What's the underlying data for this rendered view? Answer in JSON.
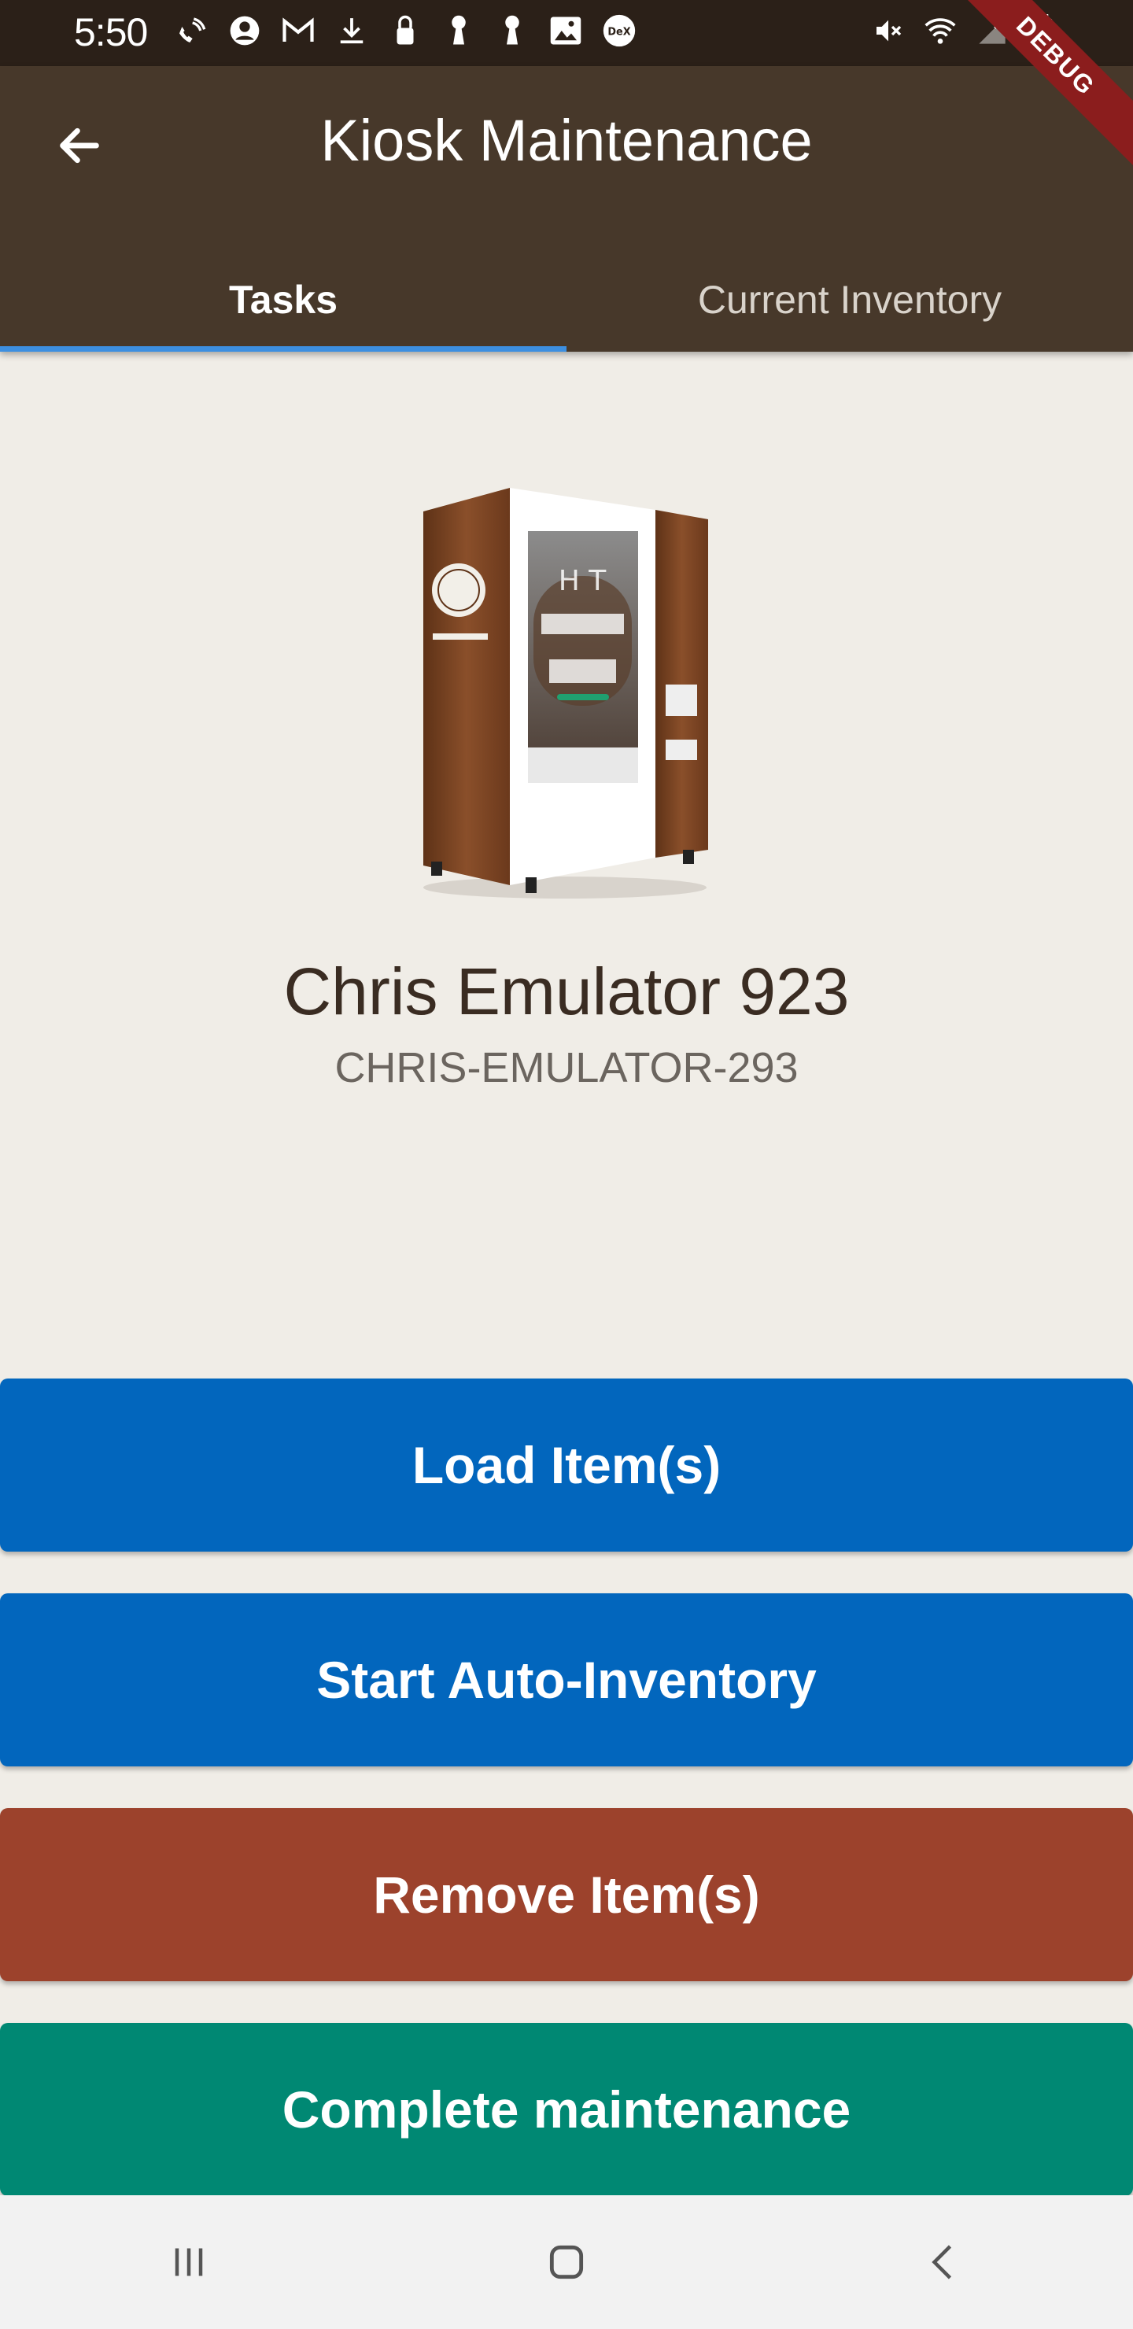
{
  "status_bar": {
    "time": "5:50",
    "icons_left": [
      "wifi-call-icon",
      "account-circle-icon",
      "gmail-icon",
      "download-icon",
      "lock-icon",
      "keyhole-icon",
      "keyhole-icon",
      "image-icon",
      "dex-icon"
    ],
    "dex_label": "DeX",
    "icons_right": [
      "mute-icon",
      "wifi-icon",
      "signal-icon",
      "battery-icon"
    ]
  },
  "debug_banner": "DEBUG",
  "app_bar": {
    "title": "Kiosk Maintenance",
    "back_icon": "arrow-left-icon"
  },
  "tabs": [
    {
      "label": "Tasks",
      "active": true
    },
    {
      "label": "Current Inventory",
      "active": false
    }
  ],
  "kiosk": {
    "name": "Chris Emulator 923",
    "id": "CHRIS-EMULATOR-293"
  },
  "actions": {
    "load": "Load Item(s)",
    "auto_inventory": "Start Auto-Inventory",
    "remove": "Remove Item(s)",
    "complete": "Complete maintenance"
  },
  "colors": {
    "app_bar": "#47382a",
    "status_bar": "#2b2018",
    "background": "#f0ede7",
    "primary_blue": "#0266bd",
    "remove_red": "#9c422c",
    "complete_green": "#008873",
    "tab_indicator": "#3d8fe0"
  },
  "nav_bar": {
    "icons": [
      "recents-icon",
      "home-icon",
      "back-icon"
    ]
  }
}
